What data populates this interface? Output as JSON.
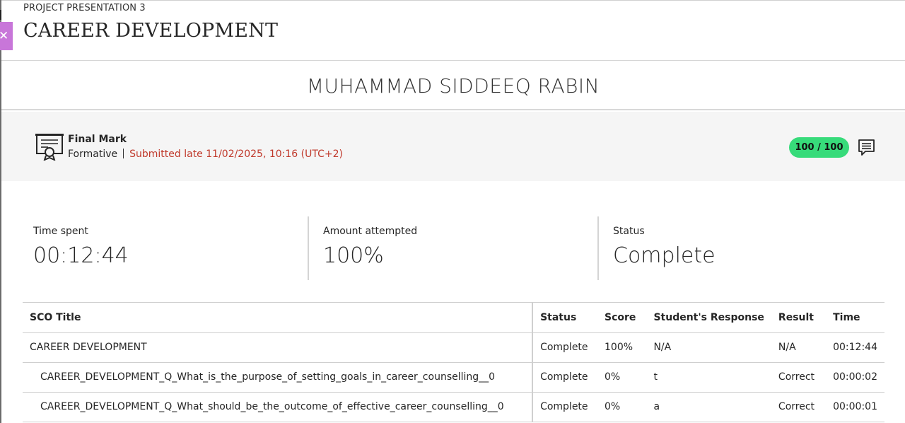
{
  "header": {
    "kicker": "PROJECT PRESENTATION 3",
    "title": "CAREER DEVELOPMENT"
  },
  "student": {
    "name": "MUHAMMAD SIDDEEQ RABIN"
  },
  "grade": {
    "label": "Final Mark",
    "type": "Formative",
    "submission": "Submitted late 11/02/2025, 10:16 (UTC+2)",
    "score": "100 / 100",
    "colors": {
      "pill": "#37db7a",
      "late": "#c0392b",
      "close_tab": "#c876d9"
    }
  },
  "stats": [
    {
      "label": "Time spent",
      "value": "00:12:44"
    },
    {
      "label": "Amount attempted",
      "value": "100%"
    },
    {
      "label": "Status",
      "value": "Complete"
    }
  ],
  "table": {
    "headers": [
      "SCO Title",
      "Status",
      "Score",
      "Student's Response",
      "Result",
      "Time"
    ],
    "rows": [
      {
        "title": "CAREER DEVELOPMENT",
        "status": "Complete",
        "score": "100%",
        "response": "N/A",
        "result": "N/A",
        "time": "00:12:44"
      },
      {
        "title": "CAREER_DEVELOPMENT_Q_What_is_the_purpose_of_setting_goals_in_career_counselling__0",
        "status": "Complete",
        "score": "0%",
        "response": "t",
        "result": "Correct",
        "time": "00:00:02"
      },
      {
        "title": "CAREER_DEVELOPMENT_Q_What_should_be_the_outcome_of_effective_career_counselling__0",
        "status": "Complete",
        "score": "0%",
        "response": "a",
        "result": "Correct",
        "time": "00:00:01"
      }
    ]
  },
  "icons": {
    "close": "close-icon",
    "certificate": "certificate-icon",
    "feedback": "feedback-icon"
  }
}
